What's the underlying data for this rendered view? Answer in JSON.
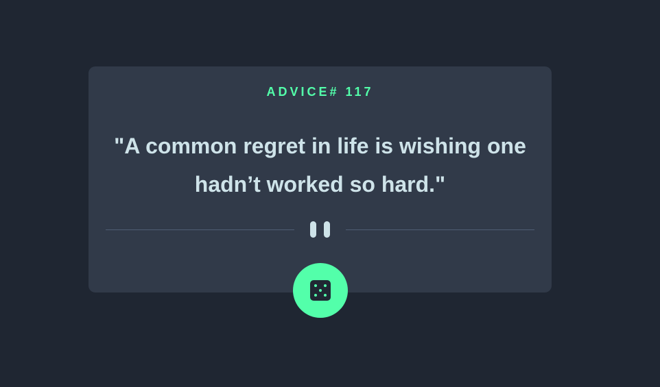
{
  "card": {
    "advice_label": "ADVICE# 117",
    "quote": "\"A common regret in life is wishing one hadn’t worked so hard.\""
  },
  "icons": {
    "divider": "pause-icon",
    "button": "dice-icon"
  },
  "colors": {
    "background": "#1f2632",
    "card": "#313a49",
    "accent": "#53ffaa",
    "text": "#cee3e9",
    "divider": "#4f5d74"
  }
}
